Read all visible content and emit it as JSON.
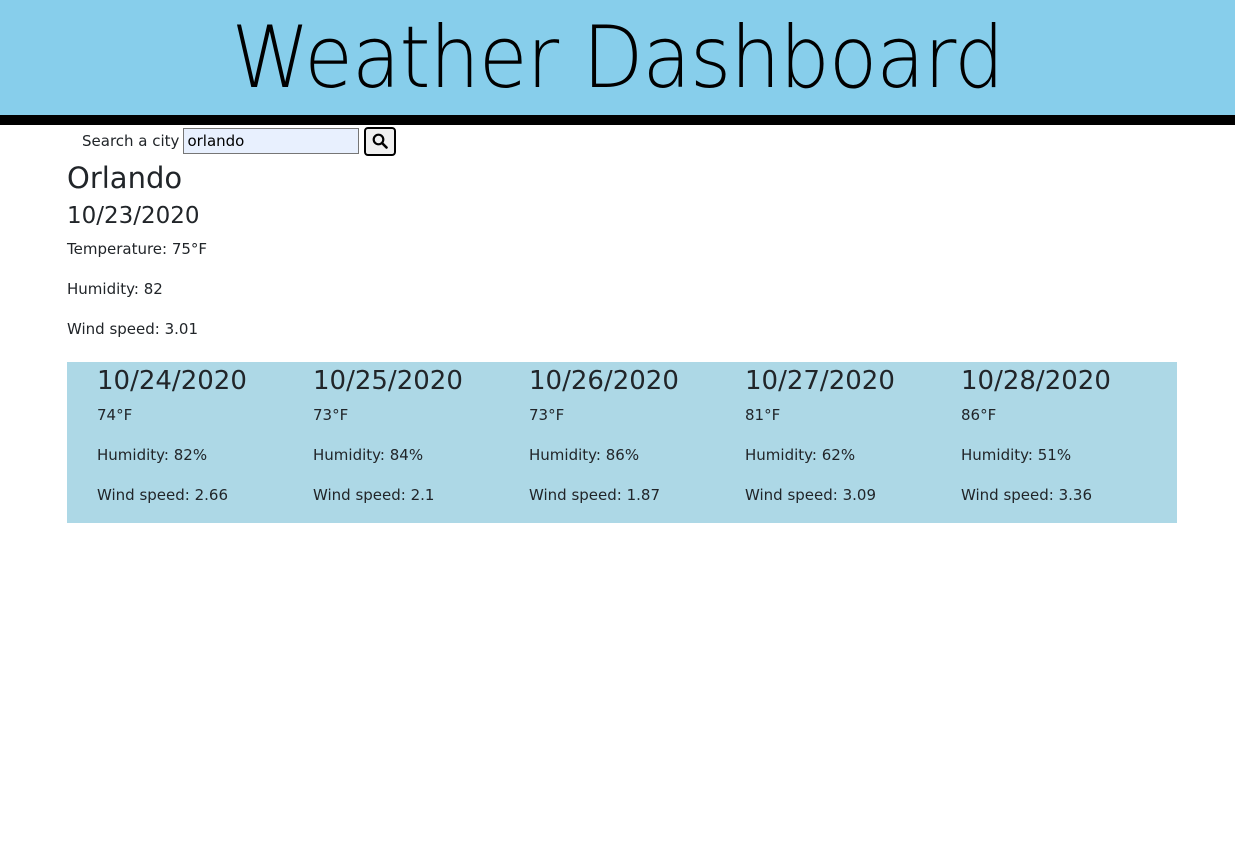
{
  "header": {
    "title": "Weather Dashboard"
  },
  "search": {
    "label": "Search a city",
    "value": "orlando",
    "placeholder": "",
    "button_icon": "search-icon"
  },
  "current": {
    "city": "Orlando",
    "date": "10/23/2020",
    "temperature": "Temperature: 75°F",
    "humidity": "Humidity: 82",
    "wind": "Wind speed: 3.01"
  },
  "forecast": [
    {
      "date": "10/24/2020",
      "temp": "74°F",
      "humidity": "Humidity: 82%",
      "wind": "Wind speed: 2.66"
    },
    {
      "date": "10/25/2020",
      "temp": "73°F",
      "humidity": "Humidity: 84%",
      "wind": "Wind speed: 2.1"
    },
    {
      "date": "10/26/2020",
      "temp": "73°F",
      "humidity": "Humidity: 86%",
      "wind": "Wind speed: 1.87"
    },
    {
      "date": "10/27/2020",
      "temp": "81°F",
      "humidity": "Humidity: 62%",
      "wind": "Wind speed: 3.09"
    },
    {
      "date": "10/28/2020",
      "temp": "86°F",
      "humidity": "Humidity: 51%",
      "wind": "Wind speed: 3.36"
    }
  ],
  "colors": {
    "header_bg": "#87ceeb",
    "header_border": "#000000",
    "forecast_bg": "#add8e6",
    "input_bg": "#e8f0fe"
  }
}
